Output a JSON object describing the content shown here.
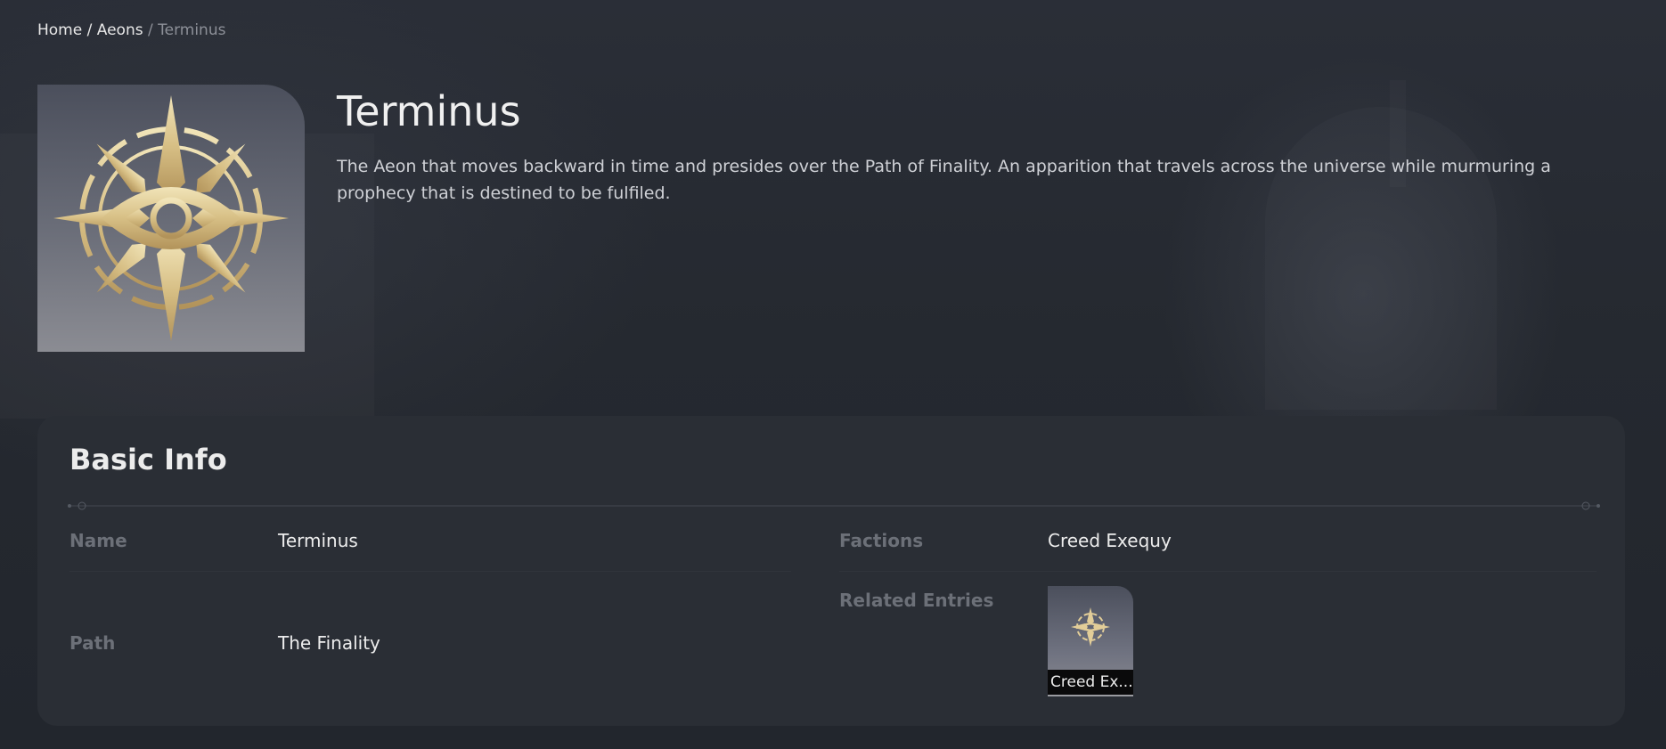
{
  "breadcrumb": {
    "home": "Home",
    "sep1": " / ",
    "section": "Aeons",
    "sep2": " / ",
    "current": "Terminus"
  },
  "hero": {
    "title": "Terminus",
    "description": "The Aeon that moves backward in time and presides over the Path of Finality. An apparition that travels across the universe while murmuring a prophecy that is destined to be fulfiled.",
    "emblem_icon": "terminus-emblem-icon"
  },
  "basic_info": {
    "heading": "Basic Info",
    "name_label": "Name",
    "name_value": "Terminus",
    "path_label": "Path",
    "path_value": "The Finality",
    "factions_label": "Factions",
    "factions_value": "Creed Exequy",
    "related_label": "Related Entries",
    "related": [
      {
        "caption": "Creed Ex...",
        "icon": "creed-exequy-emblem-icon"
      }
    ]
  },
  "colors": {
    "background": "#23272f",
    "panel": "#2a2e35",
    "label": "#6c7078",
    "gold": "#d8c28e"
  }
}
